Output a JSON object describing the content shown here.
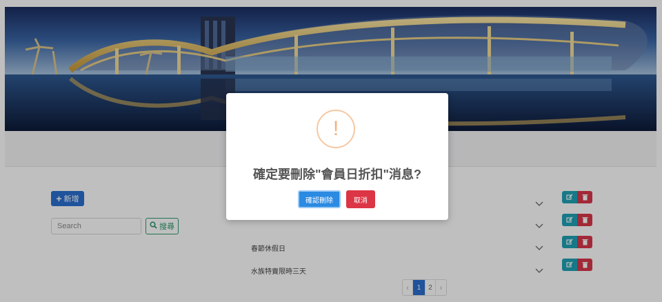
{
  "toolbar": {
    "add_label": "新增",
    "search_placeholder": "Search",
    "search_label": "搜尋"
  },
  "list": {
    "rows": [
      {
        "title": ""
      },
      {
        "title": ""
      },
      {
        "title": "春節休假日"
      },
      {
        "title": "水族特賣限時三天"
      }
    ]
  },
  "pagination": {
    "prev": "‹",
    "pages": [
      "1",
      "2"
    ],
    "current": "1",
    "next": "›"
  },
  "dialog": {
    "icon_text": "!",
    "title": "確定要刪除\"會員日折扣\"消息?",
    "confirm_label": "確認刪除",
    "cancel_label": "取消"
  },
  "colors": {
    "primary": "#2a6fd1",
    "success": "#2e9a6b",
    "info": "#1fa2b5",
    "danger": "#dc3545",
    "warning_ring": "#f6c8a1"
  },
  "icons": {
    "add": "plus-icon",
    "search": "magnifier-icon",
    "expand": "chevron-down-icon",
    "edit": "edit-icon",
    "delete": "trash-icon",
    "warning": "exclamation-icon"
  }
}
